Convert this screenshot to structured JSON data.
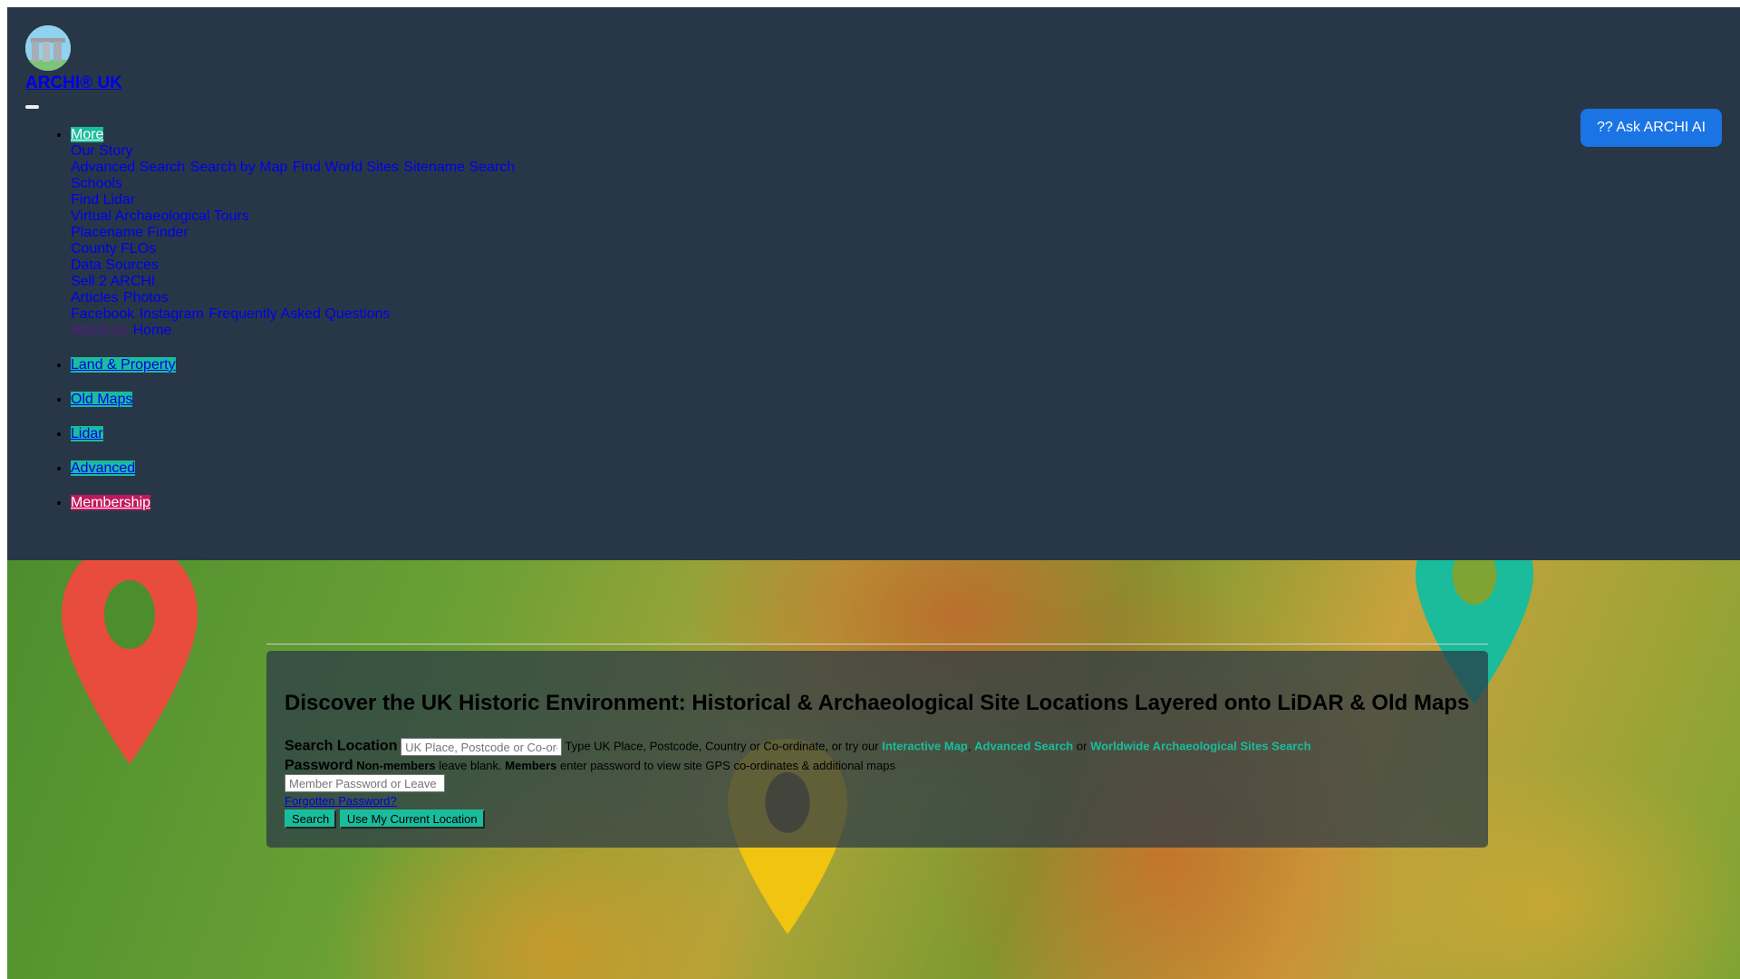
{
  "header": {
    "site_title": "ARCHI® UK",
    "ask_ai_label": "?? Ask ARCHI AI"
  },
  "nav": {
    "more_label": "More",
    "more_items": [
      [
        "Our Story"
      ],
      [
        "Advanced Search",
        "Search by Map",
        "Find World Sites",
        "Sitename Search"
      ],
      [
        "Schools"
      ],
      [
        "Find Lidar"
      ],
      [
        "Virtual Archaeological Tours"
      ],
      [
        "Placename Finder"
      ],
      [
        "County FLOs"
      ],
      [
        "Data Sources"
      ],
      [
        "Sell 2 ARCHI"
      ],
      [
        "Articles",
        "Photos"
      ],
      [
        "Facebook",
        "Instagram",
        "Frequently Asked Questions"
      ],
      [
        "About us",
        "Home"
      ]
    ],
    "items": [
      "Land & Property",
      "Old Maps",
      "Lidar",
      "Advanced",
      "Membership"
    ]
  },
  "search": {
    "heading": "Discover the UK Historic Environment: Historical & Archaeological Site Locations Layered onto LiDAR & Old Maps",
    "location_label": "Search Location",
    "location_placeholder": "UK Place, Postcode or Co-ordinate",
    "location_hint": "Type UK Place, Postcode, Country or Co-ordinate, or try our",
    "link_interactive_map": "Interactive Map",
    "comma": ",",
    "link_advanced_search": "Advanced Search",
    "or": "or",
    "link_worldwide": "Worldwide Archaeological Sites Search",
    "password_label": "Password",
    "non_members": "Non-members",
    "non_members_text": "leave blank.",
    "members": "Members",
    "members_text": "enter password to view site GPS co-ordinates & additional maps",
    "password_placeholder": "Member Password or Leave Blank",
    "forgotten": "Forgotten Password?",
    "search_button": "Search",
    "location_button": "Use My Current Location"
  },
  "colors": {
    "accent": "#1abc9c",
    "header_bg": "#283747",
    "membership": "#c2185b",
    "ask_ai": "#1b74e4"
  }
}
